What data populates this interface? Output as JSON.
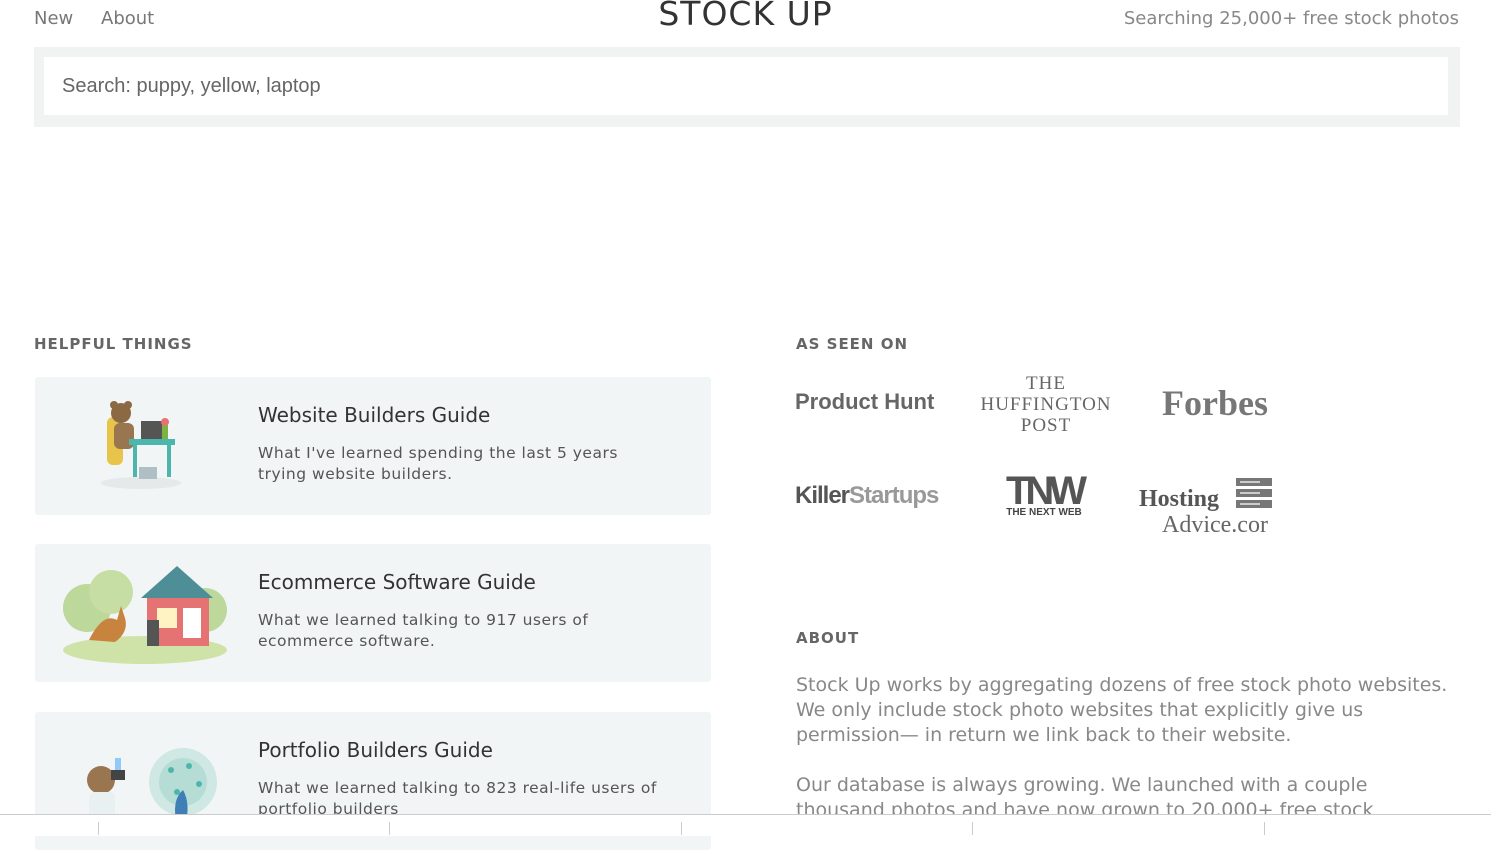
{
  "nav": {
    "new": "New",
    "about": "About"
  },
  "logo": "STOCK UP",
  "tagline": "Searching 25,000+ free stock photos",
  "search": {
    "placeholder": "Search: puppy, yellow, laptop"
  },
  "helpful": {
    "title": "HELPFUL THINGS",
    "cards": [
      {
        "title": "Website Builders Guide",
        "desc": "What I've learned spending the last 5 years trying website builders."
      },
      {
        "title": "Ecommerce Software Guide",
        "desc": "What we learned talking to 917 users of ecommerce software."
      },
      {
        "title": "Portfolio Builders Guide",
        "desc": "What we learned talking to 823 real-life users of portfolio builders"
      }
    ]
  },
  "seen": {
    "title": "AS SEEN ON",
    "logos": {
      "product_hunt": "Product Hunt",
      "huff_1": "THE",
      "huff_2": "HUFFINGTON",
      "huff_3": "POST",
      "forbes": "Forbes",
      "killer_1": "Killer",
      "killer_2": "Startups",
      "tnw_big": "TNW",
      "tnw_small": "THE NEXT WEB",
      "hosting_1": "Hosting",
      "hosting_2": "Advice.cor"
    }
  },
  "about": {
    "title": "ABOUT",
    "p1": "Stock Up works by aggregating dozens of free stock photo websites. We only include stock photo websites that explicitly give us permission— in return we link back to their website.",
    "p2": "Our database is always growing. We launched with a couple thousand photos and have now grown to 20,000+ free stock"
  }
}
